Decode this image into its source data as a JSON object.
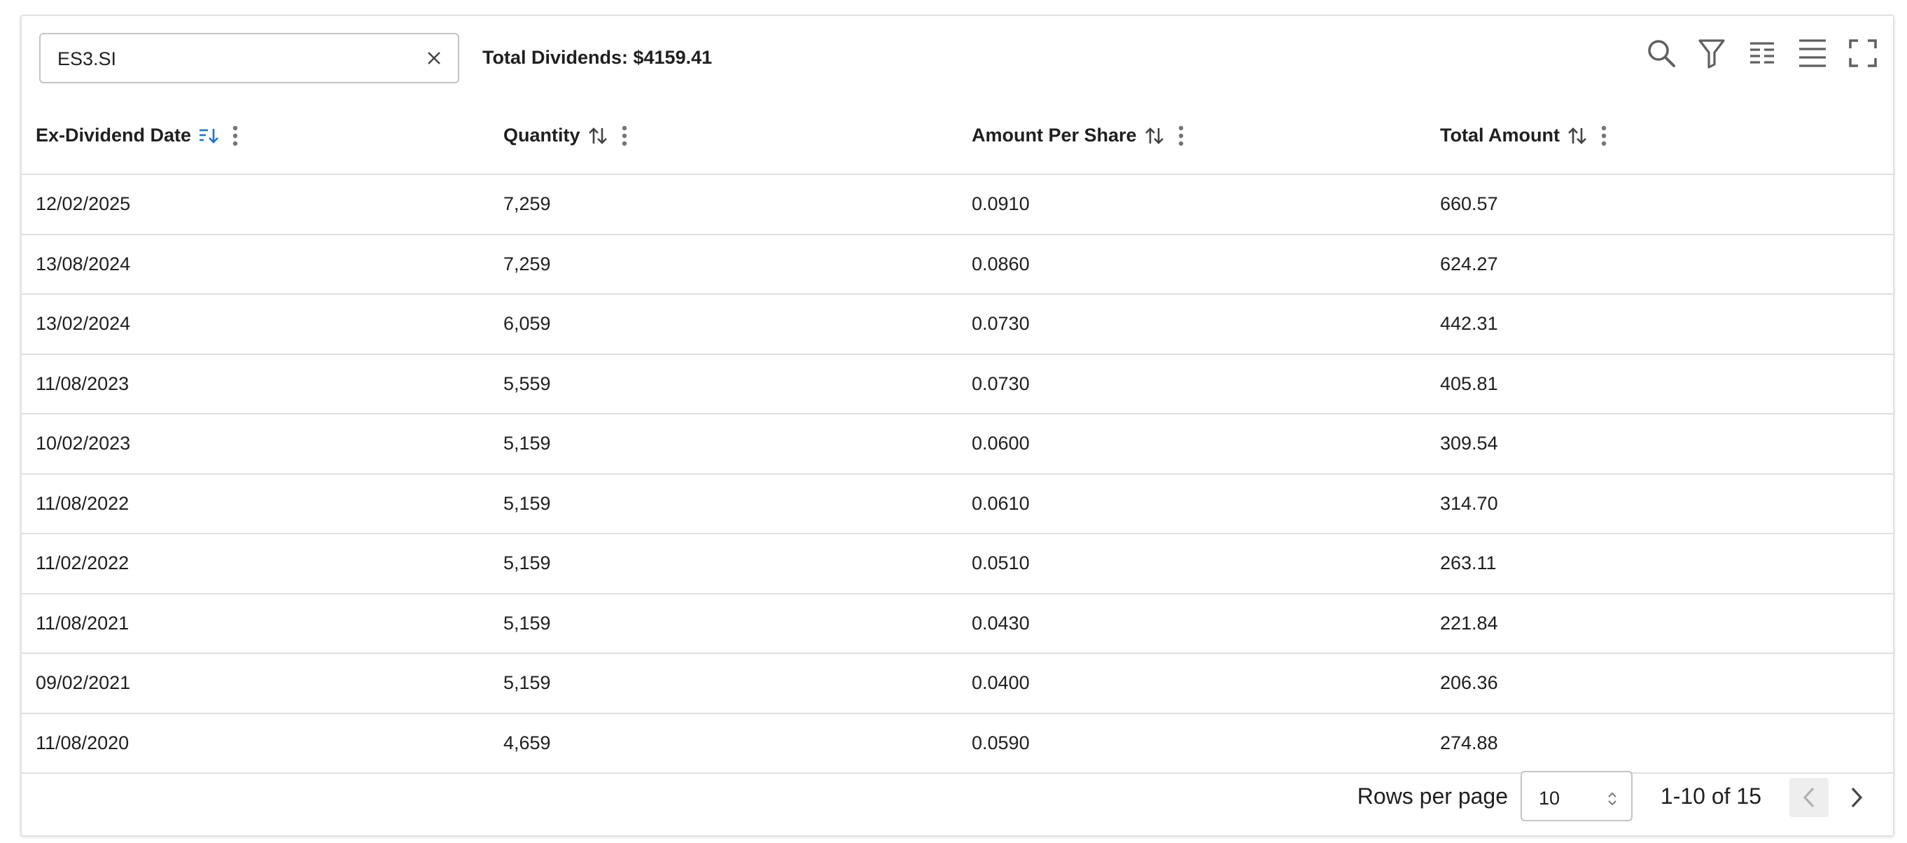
{
  "search": {
    "value": "ES3.SI"
  },
  "summary": {
    "total_dividends": "Total Dividends: $4159.41"
  },
  "toolbar": {
    "icons": [
      "search-icon",
      "filter-icon",
      "columns-icon",
      "density-icon",
      "fullscreen-icon"
    ]
  },
  "table": {
    "columns": [
      {
        "label": "Ex-Dividend Date",
        "sort": "desc"
      },
      {
        "label": "Quantity",
        "sort": "none"
      },
      {
        "label": "Amount Per Share",
        "sort": "none"
      },
      {
        "label": "Total Amount",
        "sort": "none"
      }
    ],
    "rows": [
      [
        "12/02/2025",
        "7,259",
        "0.0910",
        "660.57"
      ],
      [
        "13/08/2024",
        "7,259",
        "0.0860",
        "624.27"
      ],
      [
        "13/02/2024",
        "6,059",
        "0.0730",
        "442.31"
      ],
      [
        "11/08/2023",
        "5,559",
        "0.0730",
        "405.81"
      ],
      [
        "10/02/2023",
        "5,159",
        "0.0600",
        "309.54"
      ],
      [
        "11/08/2022",
        "5,159",
        "0.0610",
        "314.70"
      ],
      [
        "11/02/2022",
        "5,159",
        "0.0510",
        "263.11"
      ],
      [
        "11/08/2021",
        "5,159",
        "0.0430",
        "221.84"
      ],
      [
        "09/02/2021",
        "5,159",
        "0.0400",
        "206.36"
      ],
      [
        "11/08/2020",
        "4,659",
        "0.0590",
        "274.88"
      ]
    ]
  },
  "pagination": {
    "rows_per_page_label": "Rows per page",
    "rows_per_page_value": "10",
    "range": "1-10 of 15"
  },
  "colors": {
    "accent": "#1976d2",
    "border": "#e0e0e0",
    "icon": "#616161"
  }
}
